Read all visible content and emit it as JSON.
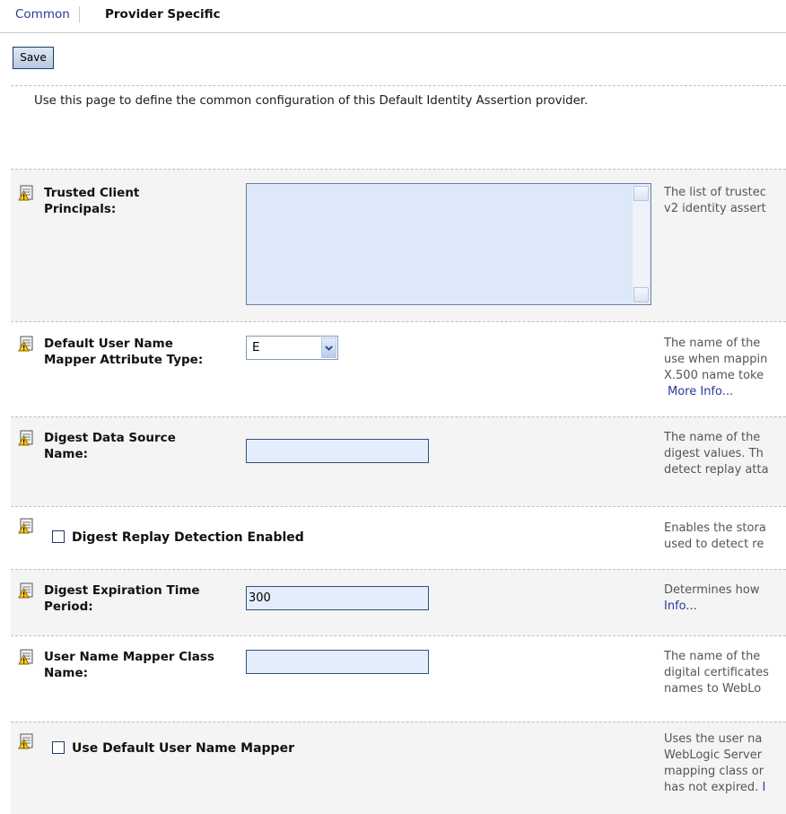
{
  "tabs": {
    "common": "Common",
    "provider_specific": "Provider Specific"
  },
  "toolbar": {
    "save_label": "Save"
  },
  "intro": "Use this page to define the common configuration of this Default Identity Assertion provider.",
  "fields": {
    "trusted_client_principals": {
      "label_line1": "Trusted Client",
      "label_line2": "Principals:",
      "value": "",
      "help_line1": "The list of trustec",
      "help_line2": "v2 identity assert"
    },
    "default_user_name_mapper_attribute_type": {
      "label_line1": "Default User Name",
      "label_line2": "Mapper Attribute Type:",
      "value": "E",
      "help_line1": "The name of the",
      "help_line2": "use when mappin",
      "help_line3": "X.500 name toke",
      "help_link": "More Info..."
    },
    "digest_data_source_name": {
      "label_line1": "Digest Data Source",
      "label_line2": "Name:",
      "value": "",
      "help_line1": "The name of the",
      "help_line2": "digest values. Th",
      "help_line3": "detect replay atta"
    },
    "digest_replay_detection_enabled": {
      "label": "Digest Replay Detection Enabled",
      "checked": false,
      "help_line1": "Enables the stora",
      "help_line2": "used to detect re"
    },
    "digest_expiration_time_period": {
      "label_line1": "Digest Expiration Time",
      "label_line2": "Period:",
      "value": "300",
      "help_line1": "Determines how",
      "help_link": "Info..."
    },
    "user_name_mapper_class_name": {
      "label_line1": "User Name Mapper Class",
      "label_line2": "Name:",
      "value": "",
      "help_line1": "The name of the",
      "help_line2": "digital certificates",
      "help_line3": "names to WebLo"
    },
    "use_default_user_name_mapper": {
      "label": "Use Default User Name Mapper",
      "checked": false,
      "help_line1": "Uses the user na",
      "help_line2": "WebLogic Server",
      "help_line3": "mapping class or",
      "help_line4": "has not expired.",
      "help_link": "I"
    }
  },
  "icons": {
    "warning": "warning-note-icon"
  },
  "colors": {
    "link": "#2a3a9a",
    "input_bg": "#e4edfb",
    "row_bg": "#f4f4f4"
  }
}
